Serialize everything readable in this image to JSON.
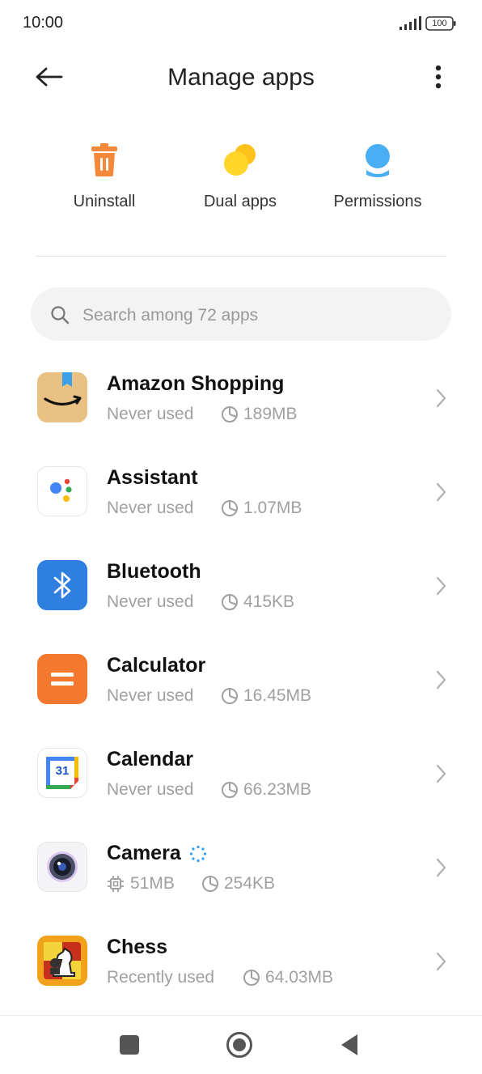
{
  "status": {
    "time": "10:00",
    "battery": "100"
  },
  "header": {
    "title": "Manage apps"
  },
  "shortcuts": [
    {
      "label": "Uninstall",
      "icon": "trash-icon"
    },
    {
      "label": "Dual apps",
      "icon": "dual-apps-icon"
    },
    {
      "label": "Permissions",
      "icon": "permissions-icon"
    }
  ],
  "search": {
    "placeholder": "Search among 72 apps"
  },
  "apps": [
    {
      "name": "Amazon Shopping",
      "meta": "Never used",
      "size": "189MB"
    },
    {
      "name": "Assistant",
      "meta": "Never used",
      "size": "1.07MB"
    },
    {
      "name": "Bluetooth",
      "meta": "Never used",
      "size": "415KB"
    },
    {
      "name": "Calculator",
      "meta": "Never used",
      "size": "16.45MB"
    },
    {
      "name": "Calendar",
      "meta": "Never used",
      "size": "66.23MB",
      "calendar_day": "31"
    },
    {
      "name": "Camera",
      "meta": "51MB",
      "size": "254KB"
    },
    {
      "name": "Chess",
      "meta": "Recently used",
      "size": "64.03MB"
    }
  ],
  "colors": {
    "uninstall": "#f5893b",
    "dual_apps": "#ffd52a",
    "permissions": "#4aaef5",
    "bluetooth": "#2f7fe0",
    "calculator": "#f5782f"
  }
}
